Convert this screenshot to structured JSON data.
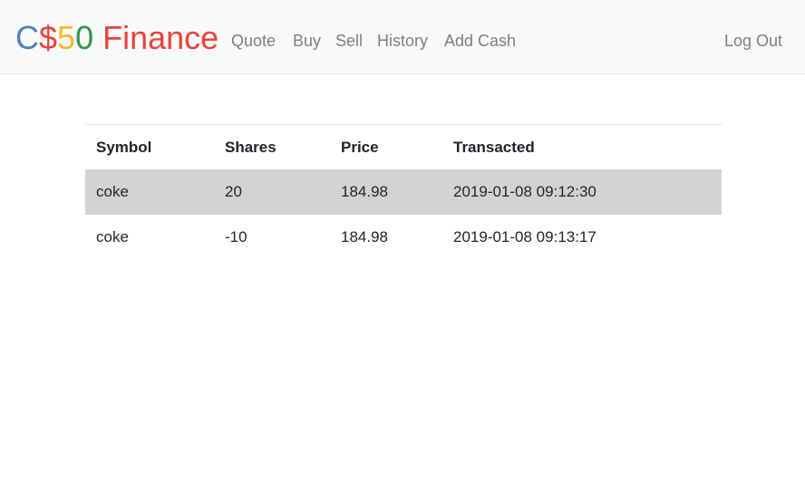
{
  "brand": {
    "parts": [
      "C",
      "$",
      "5",
      "0",
      " Finance"
    ],
    "colors": [
      "#537fbe",
      "#ea433b",
      "#f5b82e",
      "#2e944b",
      "#ea433b"
    ]
  },
  "nav": {
    "links": [
      "Quote",
      "Buy",
      "Sell",
      "History",
      "Add Cash"
    ],
    "logout": "Log Out"
  },
  "history_table": {
    "columns": [
      "Symbol",
      "Shares",
      "Price",
      "Transacted"
    ],
    "rows": [
      [
        "coke",
        "20",
        "184.98",
        "2019-01-08 09:12:30"
      ],
      [
        "coke",
        "-10",
        "184.98",
        "2019-01-08 09:13:17"
      ]
    ]
  }
}
